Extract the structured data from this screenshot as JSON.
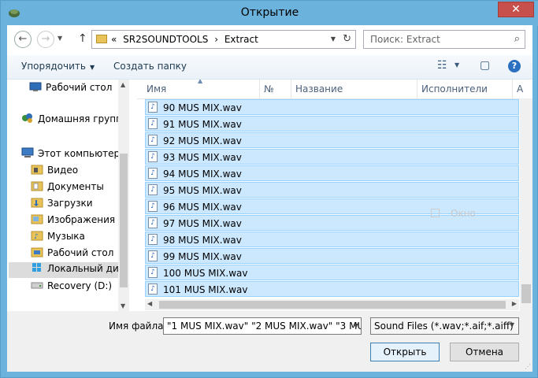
{
  "window": {
    "title": "Открытие",
    "close_label": "✕"
  },
  "address": {
    "crumbs": [
      "«",
      "SR2SOUNDTOOLS",
      "›",
      "Extract"
    ],
    "search_placeholder": "Поиск: Extract"
  },
  "toolbar": {
    "organize_label": "Упорядочить",
    "new_folder_label": "Создать папку"
  },
  "nav": {
    "items": [
      {
        "label": "Рабочий стол"
      },
      {
        "label": "Домашняя группа"
      },
      {
        "label": "Этот компьютер"
      },
      {
        "label": "Видео"
      },
      {
        "label": "Документы"
      },
      {
        "label": "Загрузки"
      },
      {
        "label": "Изображения"
      },
      {
        "label": "Музыка"
      },
      {
        "label": "Рабочий стол"
      },
      {
        "label": "Локальный диск"
      },
      {
        "label": "Recovery (D:)"
      }
    ]
  },
  "columns": {
    "name": "Имя",
    "number": "№",
    "title": "Название",
    "artists": "Исполнители",
    "extra": "А"
  },
  "files": [
    {
      "name": "90 MUS MIX.wav"
    },
    {
      "name": "91 MUS MIX.wav"
    },
    {
      "name": "92 MUS MIX.wav"
    },
    {
      "name": "93 MUS MIX.wav"
    },
    {
      "name": "94 MUS MIX.wav"
    },
    {
      "name": "95 MUS MIX.wav"
    },
    {
      "name": "96 MUS MIX.wav"
    },
    {
      "name": "97 MUS MIX.wav"
    },
    {
      "name": "98 MUS MIX.wav"
    },
    {
      "name": "99 MUS MIX.wav"
    },
    {
      "name": "100 MUS MIX.wav"
    },
    {
      "name": "101 MUS MIX.wav"
    }
  ],
  "ghost_label": "Окно",
  "bottom": {
    "filename_label": "Имя файла:",
    "filename_value": "\"1 MUS MIX.wav\" \"2 MUS MIX.wav\" \"3 MUS",
    "filetype_value": "Sound Files (*.wav;*.aif;*.aiff)",
    "open_label": "Открыть",
    "cancel_label": "Отмена"
  },
  "colors": {
    "title_bar": "#6bb2dd",
    "close": "#c7504c",
    "selection": "#cce8ff",
    "selection_border": "#99d1ff"
  }
}
